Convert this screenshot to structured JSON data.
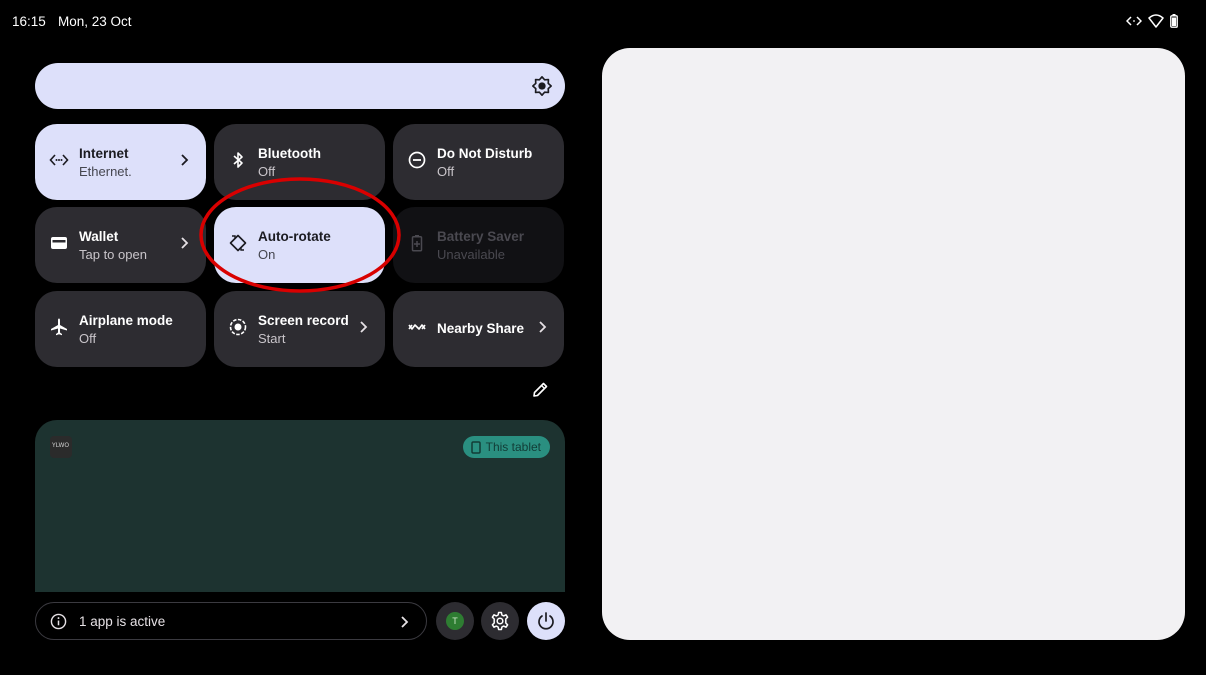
{
  "status_bar": {
    "time": "16:15",
    "date": "Mon, 23 Oct",
    "icons": [
      "ethernet-icon",
      "wifi-icon",
      "battery-icon"
    ]
  },
  "brightness": {
    "icon": "brightness-icon",
    "level": 1.0
  },
  "tiles": [
    {
      "label": "Internet",
      "sub": "Ethernet.",
      "icon": "ethernet-icon",
      "state": "on",
      "has_chevron": true
    },
    {
      "label": "Bluetooth",
      "sub": "Off",
      "icon": "bluetooth-icon",
      "state": "off",
      "has_chevron": false
    },
    {
      "label": "Do Not Disturb",
      "sub": "Off",
      "icon": "do-not-disturb-icon",
      "state": "off",
      "has_chevron": false
    },
    {
      "label": "Wallet",
      "sub": "Tap to open",
      "icon": "wallet-icon",
      "state": "off",
      "has_chevron": true
    },
    {
      "label": "Auto-rotate",
      "sub": "On",
      "icon": "auto-rotate-icon",
      "state": "on",
      "has_chevron": false
    },
    {
      "label": "Battery Saver",
      "sub": "Unavailable",
      "icon": "battery-saver-icon",
      "state": "disabled",
      "has_chevron": false
    },
    {
      "label": "Airplane mode",
      "sub": "Off",
      "icon": "airplane-icon",
      "state": "off",
      "has_chevron": false
    },
    {
      "label": "Screen record",
      "sub": "Start",
      "icon": "screen-record-icon",
      "state": "off",
      "has_chevron": true
    },
    {
      "label": "Nearby Share",
      "sub": "",
      "icon": "nearby-share-icon",
      "state": "off",
      "has_chevron": true
    }
  ],
  "edit": {
    "icon": "pencil-icon"
  },
  "media": {
    "app_icon_text": "YLWO",
    "device_chip": "This tablet",
    "device_icon": "tablet-icon"
  },
  "footer": {
    "active_apps_label": "1 app is active",
    "user_initial": "T",
    "settings_icon": "gear-icon",
    "power_icon": "power-icon"
  },
  "colors": {
    "background": "#000000",
    "tile_off": "#2d2c31",
    "tile_on": "#dde0fa",
    "media_card": "#1d3330",
    "chip": "#2a8f80",
    "highlight": "#d90000",
    "right_panel": "#f2f1f3"
  }
}
